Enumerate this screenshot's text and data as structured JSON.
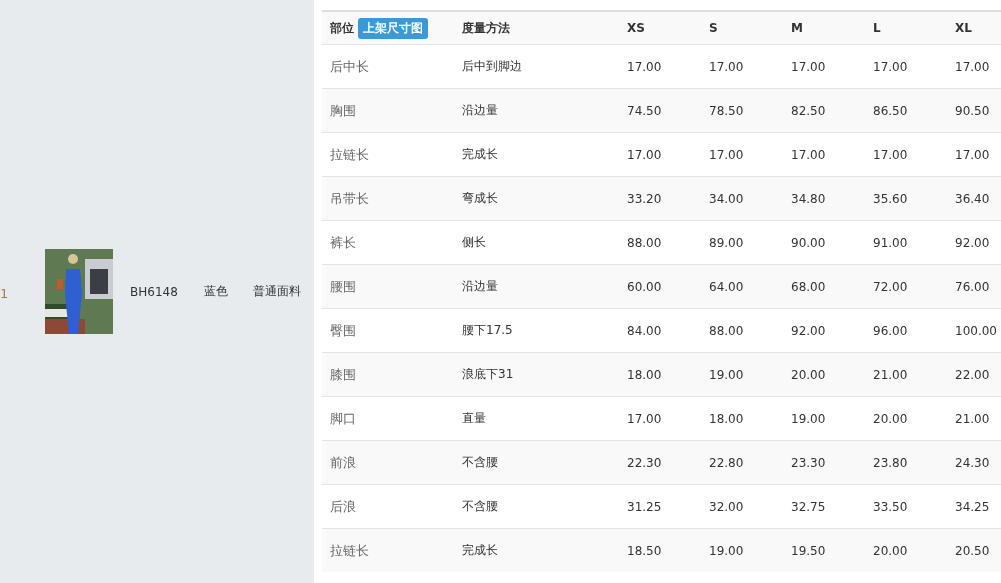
{
  "product": {
    "index": "1",
    "style_code": "BH6148",
    "color_name": "蓝色",
    "fabric": "普通面料"
  },
  "size_table": {
    "columns": [
      {
        "label": "部位",
        "badge": "上架尺寸图"
      },
      {
        "label": "度量方法"
      },
      {
        "label": "XS"
      },
      {
        "label": "S"
      },
      {
        "label": "M"
      },
      {
        "label": "L"
      },
      {
        "label": "XL"
      }
    ],
    "rows": [
      {
        "part": "后中长",
        "method": "后中到脚边",
        "values": [
          "17.00",
          "17.00",
          "17.00",
          "17.00",
          "17.00"
        ]
      },
      {
        "part": "胸围",
        "method": "沿边量",
        "values": [
          "74.50",
          "78.50",
          "82.50",
          "86.50",
          "90.50"
        ]
      },
      {
        "part": "拉链长",
        "method": "完成长",
        "values": [
          "17.00",
          "17.00",
          "17.00",
          "17.00",
          "17.00"
        ]
      },
      {
        "part": "吊带长",
        "method": "弯成长",
        "values": [
          "33.20",
          "34.00",
          "34.80",
          "35.60",
          "36.40"
        ]
      },
      {
        "part": "裤长",
        "method": "侧长",
        "values": [
          "88.00",
          "89.00",
          "90.00",
          "91.00",
          "92.00"
        ]
      },
      {
        "part": "腰围",
        "method": "沿边量",
        "values": [
          "60.00",
          "64.00",
          "68.00",
          "72.00",
          "76.00"
        ]
      },
      {
        "part": "臀围",
        "method": "腰下17.5",
        "values": [
          "84.00",
          "88.00",
          "92.00",
          "96.00",
          "100.00"
        ]
      },
      {
        "part": "膝围",
        "method": "浪底下31",
        "values": [
          "18.00",
          "19.00",
          "20.00",
          "21.00",
          "22.00"
        ]
      },
      {
        "part": "脚口",
        "method": "直量",
        "values": [
          "17.00",
          "18.00",
          "19.00",
          "20.00",
          "21.00"
        ]
      },
      {
        "part": "前浪",
        "method": "不含腰",
        "values": [
          "22.30",
          "22.80",
          "23.30",
          "23.80",
          "24.30"
        ]
      },
      {
        "part": "后浪",
        "method": "不含腰",
        "values": [
          "31.25",
          "32.00",
          "32.75",
          "33.50",
          "34.25"
        ]
      },
      {
        "part": "拉链长",
        "method": "完成长",
        "values": [
          "18.50",
          "19.00",
          "19.50",
          "20.00",
          "20.50"
        ]
      }
    ]
  }
}
